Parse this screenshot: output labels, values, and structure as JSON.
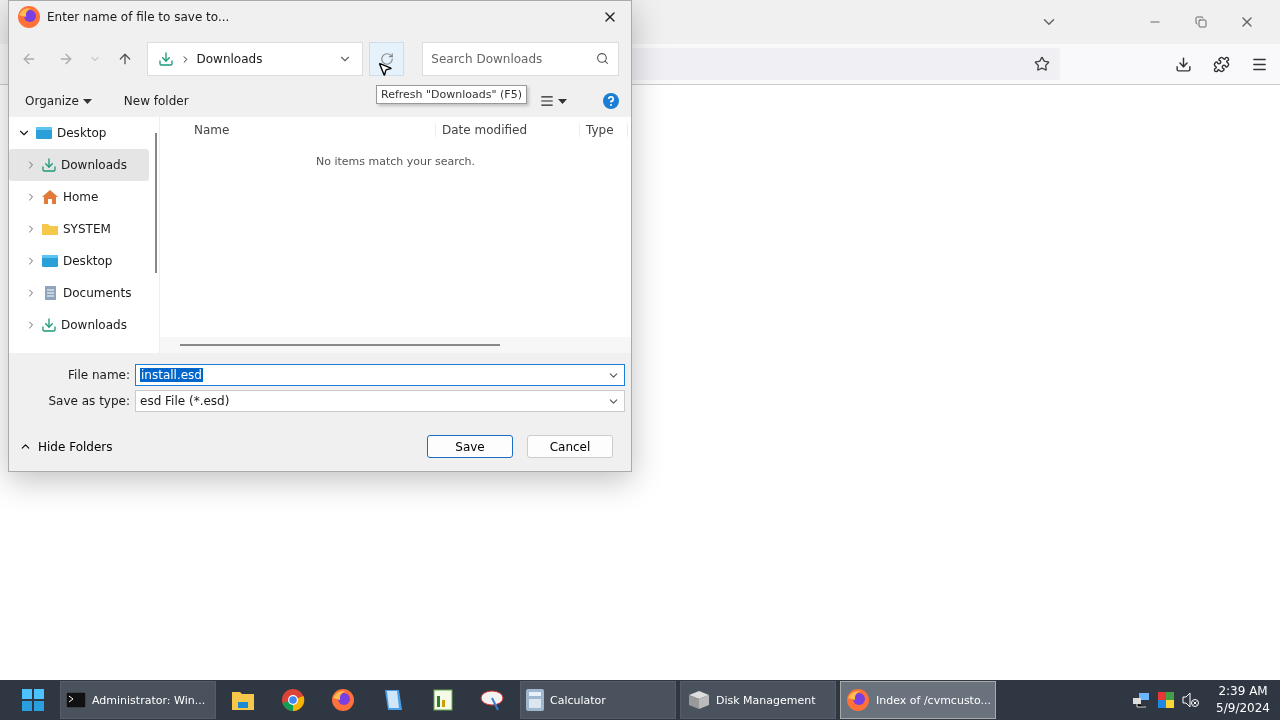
{
  "dialog": {
    "title": "Enter name of file to save to...",
    "address": {
      "path": "Downloads"
    },
    "tooltip": "Refresh \"Downloads\" (F5)",
    "search": {
      "placeholder": "Search Downloads"
    },
    "toolbar": {
      "organize": "Organize",
      "new_folder": "New folder"
    },
    "tree": [
      {
        "label": "Desktop",
        "kind": "desktop",
        "expanded": true,
        "selected": false,
        "children": [
          {
            "label": "Downloads",
            "kind": "download",
            "expanded": false,
            "selected": true
          },
          {
            "label": "Home",
            "kind": "home",
            "expanded": false,
            "selected": false
          },
          {
            "label": "SYSTEM",
            "kind": "folder",
            "expanded": false,
            "selected": false
          },
          {
            "label": "Desktop",
            "kind": "desktop",
            "expanded": false,
            "selected": false
          },
          {
            "label": "Documents",
            "kind": "documents",
            "expanded": false,
            "selected": false
          },
          {
            "label": "Downloads",
            "kind": "download",
            "expanded": false,
            "selected": false
          }
        ]
      }
    ],
    "columns": [
      "Name",
      "Date modified",
      "Type"
    ],
    "empty_message": "No items match your search.",
    "file_name": {
      "label": "File name:",
      "value": "install.esd"
    },
    "save_as_type": {
      "label": "Save as type:",
      "value": "esd File (*.esd)"
    },
    "hide_folders": "Hide Folders",
    "buttons": [
      {
        "label": "Save",
        "default": true
      },
      {
        "label": "Cancel",
        "default": false
      }
    ]
  },
  "taskbar": {
    "items": [
      {
        "kind": "terminal",
        "label": "Administrator: Win...",
        "selected": false
      },
      {
        "kind": "explorer"
      },
      {
        "kind": "chrome"
      },
      {
        "kind": "firefox"
      },
      {
        "kind": "notepad"
      },
      {
        "kind": "chart"
      },
      {
        "kind": "satellite"
      },
      {
        "kind": "calculator",
        "label": "Calculator",
        "selected": false
      },
      {
        "kind": "disk",
        "label": "Disk Management",
        "selected": false
      },
      {
        "kind": "firefox",
        "label": "Index of /cvmcusto...",
        "selected": true
      }
    ],
    "clock": {
      "time": "2:39 AM",
      "date": "5/9/2024"
    }
  }
}
